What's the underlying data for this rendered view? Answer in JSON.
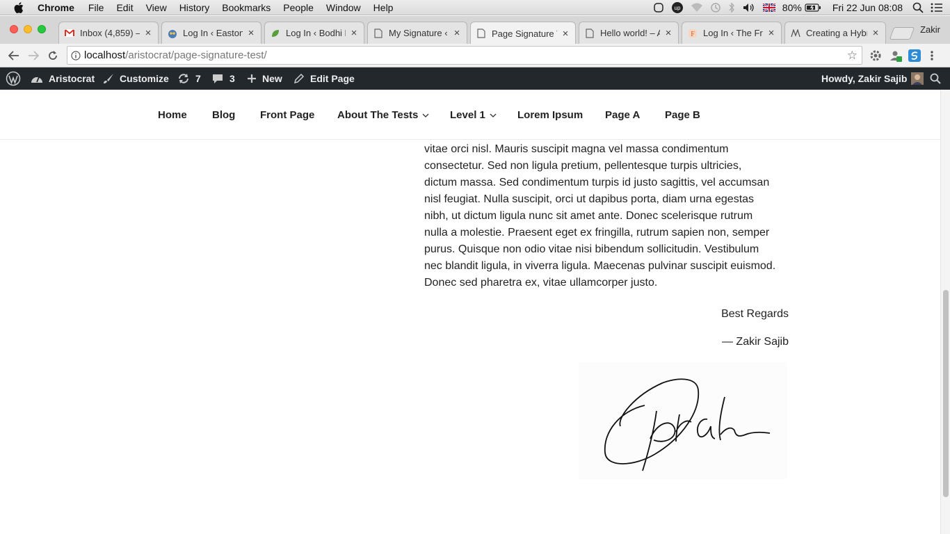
{
  "macos": {
    "menus": [
      "Chrome",
      "File",
      "Edit",
      "View",
      "History",
      "Bookmarks",
      "People",
      "Window",
      "Help"
    ],
    "battery": "80%",
    "datetime": "Fri 22 Jun  08:08"
  },
  "browser": {
    "profile_name": "Zakir",
    "tabs": [
      {
        "title": "Inbox (4,859) –",
        "icon": "gmail-icon"
      },
      {
        "title": "Log In ‹ Easton",
        "icon": "owl-icon"
      },
      {
        "title": "Log In ‹ Bodhi Ex",
        "icon": "leaf-icon"
      },
      {
        "title": "My Signature ‹ A",
        "icon": "page-icon"
      },
      {
        "title": "Page Signature T",
        "icon": "page-icon",
        "active": true
      },
      {
        "title": "Hello world! – Ar",
        "icon": "page-icon"
      },
      {
        "title": "Log In ‹ The Fror",
        "icon": "frontier-icon"
      },
      {
        "title": "Creating a Hybri",
        "icon": "hybrid-icon"
      }
    ],
    "url_host": "localhost",
    "url_path": "/aristocrat/page-signature-test/"
  },
  "adminbar": {
    "site_name": "Aristocrat",
    "customize": "Customize",
    "updates_count": "7",
    "comments_count": "3",
    "new_label": "New",
    "edit_page": "Edit Page",
    "howdy": "Howdy, Zakir Sajib"
  },
  "site_nav": {
    "items": [
      "Home",
      "Blog",
      "Front Page",
      "About The Tests",
      "Level 1",
      "Lorem Ipsum",
      "Page A",
      "Page B"
    ]
  },
  "content": {
    "paragraph_lines": [
      "vitae orci nisl. Mauris suscipit magna vel massa condimentum",
      "consectetur. Sed non ligula pretium, pellentesque turpis ultricies,",
      "dictum massa. Sed condimentum turpis id justo sagittis, vel accumsan",
      "nisl feugiat. Nulla suscipit, orci ut dapibus porta, diam urna egestas",
      "nibh, ut dictum ligula nunc sit amet ante. Donec scelerisque rutrum",
      "nulla a molestie. Praesent eget ex fringilla, rutrum sapien non, semper",
      "purus. Quisque non odio vitae nisi bibendum sollicitudin. Vestibulum",
      "nec blandit ligula, in viverra ligula. Maecenas pulvinar suscipit euismod.",
      "Donec sed pharetra ex, vitae ullamcorper justo."
    ],
    "closing": "Best Regards",
    "author": "— Zakir Sajib"
  },
  "colors": {
    "admin_bar": "#23282d",
    "tab_strip": "#d6d6d6",
    "close_red": "#fc5f57",
    "minimize_yellow": "#fdbc2e",
    "zoom_green": "#28c840"
  }
}
